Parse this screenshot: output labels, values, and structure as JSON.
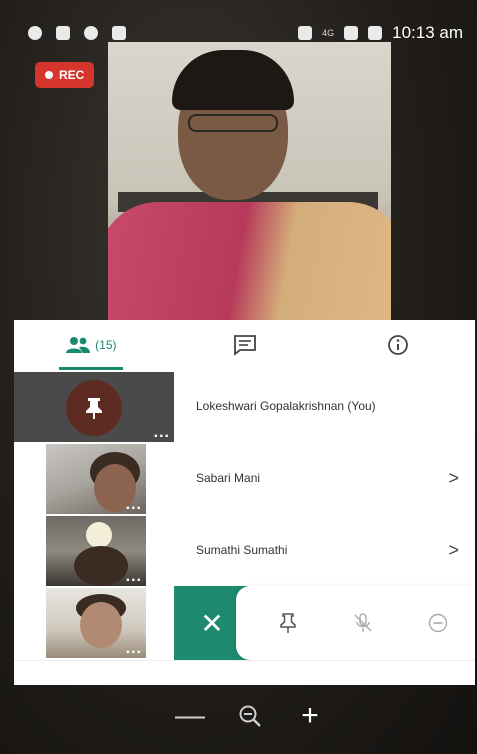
{
  "status_bar": {
    "time": "10:13 am",
    "network": "4G"
  },
  "recording": {
    "label": "REC"
  },
  "tabs": [
    {
      "icon": "people-icon",
      "label": "(15)",
      "active": true
    },
    {
      "icon": "chat-icon",
      "label": "",
      "active": false
    },
    {
      "icon": "info-icon",
      "label": "",
      "active": false
    }
  ],
  "participants": [
    {
      "name": "Lokeshwari Gopalakrishnan (You)"
    },
    {
      "name": "Sabari Mani"
    },
    {
      "name": "Sumathi Sumathi"
    }
  ],
  "tile_more": "...",
  "actions": {
    "close": "✕"
  },
  "zoom": {
    "minus": "—",
    "plus": "+"
  },
  "colors": {
    "accent": "#1e8a70",
    "rec": "#d6352c"
  }
}
